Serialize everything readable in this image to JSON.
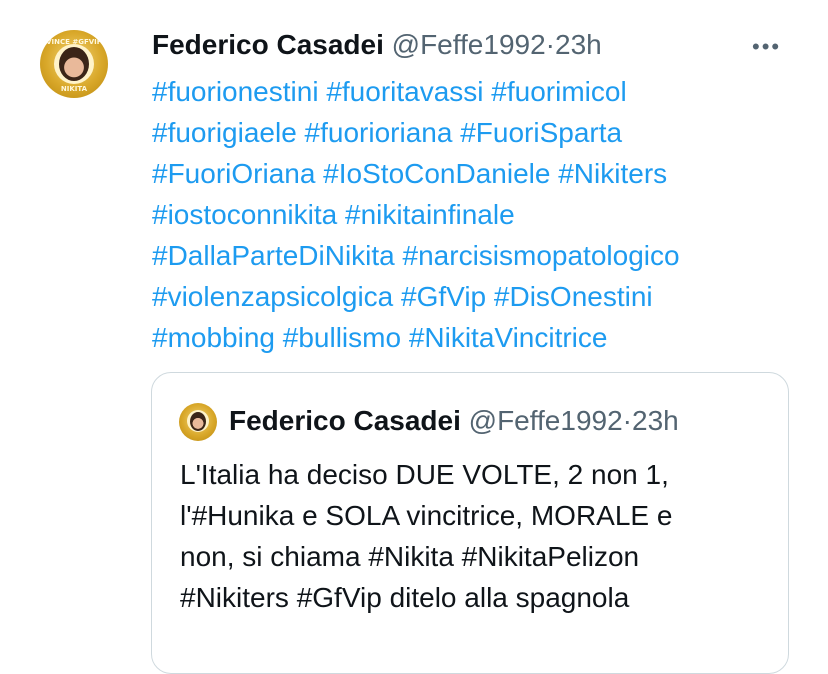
{
  "tweet": {
    "author_name": "Federico Casadei",
    "handle": "@Feffe1992",
    "separator": "·",
    "time": "23h",
    "more": "•••",
    "avatar": {
      "top_text": "VINCE #GFVIP",
      "bottom_text": "NIKITA"
    },
    "text_lines": [
      "#fuorionestini #fuoritavassi #fuorimicol",
      "#fuorigiaele #fuorioriana #FuoriSparta",
      "#FuoriOriana #IoStoConDaniele #Nikiters",
      "#iostoconnikita #nikitainfinale",
      "#DallaParteDiNikita #narcisismopatologico",
      "#violenzapsicolgica #GfVip #DisOnestini",
      "#mobbing #bullismo #NikitaVincitrice"
    ]
  },
  "quote": {
    "author_name": "Federico Casadei",
    "handle": "@Feffe1992",
    "separator": "·",
    "time": "23h",
    "text_lines": [
      "L'Italia ha deciso DUE VOLTE, 2 non 1,",
      "l'#Hunika e SOLA vincitrice, MORALE e",
      "non, si chiama #Nikita #NikitaPelizon",
      "#Nikiters #GfVip ditelo alla spagnola"
    ]
  },
  "colors": {
    "link": "#1d9bf0",
    "text": "#0f1419",
    "secondary": "#536471",
    "border": "#cfd9de"
  }
}
